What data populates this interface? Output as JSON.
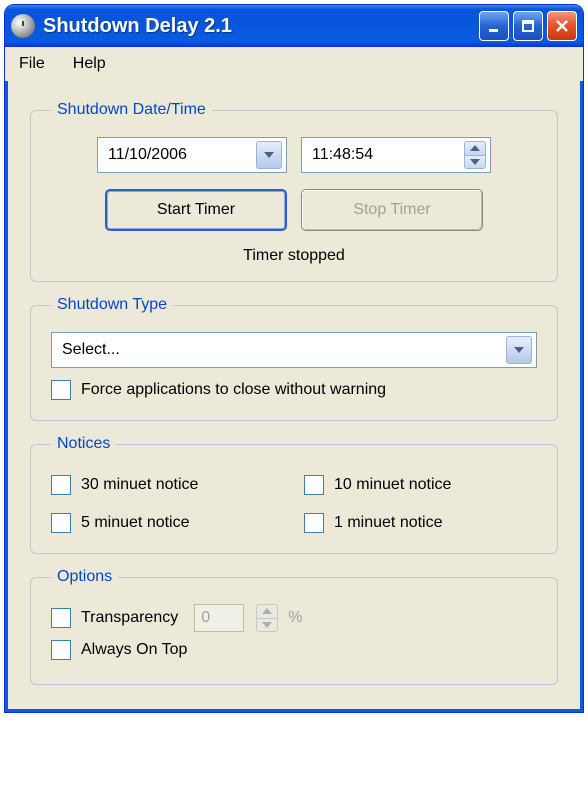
{
  "window": {
    "title": "Shutdown Delay 2.1"
  },
  "menubar": {
    "file": "File",
    "help": "Help"
  },
  "datetime": {
    "legend": "Shutdown Date/Time",
    "date": "11/10/2006",
    "time": "11:48:54",
    "start_label": "Start Timer",
    "stop_label": "Stop Timer",
    "status": "Timer stopped"
  },
  "shutdown_type": {
    "legend": "Shutdown Type",
    "selected": "Select...",
    "force_label": "Force applications to close without warning",
    "force_checked": false
  },
  "notices": {
    "legend": "Notices",
    "items": [
      {
        "label": "30 minuet notice",
        "checked": false
      },
      {
        "label": "10 minuet notice",
        "checked": false
      },
      {
        "label": "5 minuet notice",
        "checked": false
      },
      {
        "label": "1 minuet notice",
        "checked": false
      }
    ]
  },
  "options": {
    "legend": "Options",
    "transparency_label": "Transparency",
    "transparency_value": "0",
    "transparency_unit": "%",
    "transparency_checked": false,
    "always_on_top_label": "Always On Top",
    "always_on_top_checked": false
  }
}
